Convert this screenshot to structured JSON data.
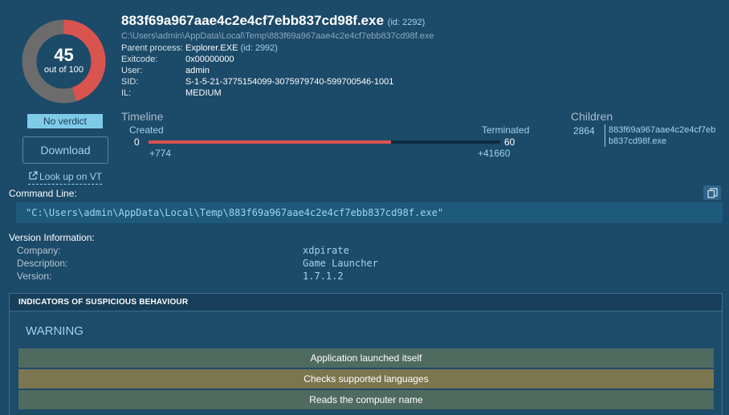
{
  "score": {
    "value": "45",
    "caption": "out of 100",
    "fraction": 0.45,
    "color_danger": "#d9534f",
    "color_track": "#6c6c6c"
  },
  "verdict": "No verdict",
  "download_label": "Download",
  "vt_label": "Look up on VT",
  "process": {
    "name": "883f69a967aae4c2e4cf7ebb837cd98f.exe",
    "id_text": "(id: 2292)",
    "path": "C:\\Users\\admin\\AppData\\Local\\Temp\\883f69a967aae4c2e4cf7ebb837cd98f.exe",
    "fields": [
      {
        "key": "Parent process:",
        "value": "Explorer.EXE",
        "sub": "(id: 2992)"
      },
      {
        "key": "Exitcode:",
        "value": "0x00000000",
        "sub": ""
      },
      {
        "key": "User:",
        "value": "admin",
        "sub": ""
      },
      {
        "key": "SID:",
        "value": "S-1-5-21-3775154099-3075979740-599700546-1001",
        "sub": ""
      },
      {
        "key": "IL:",
        "value": "MEDIUM",
        "sub": ""
      }
    ]
  },
  "timeline": {
    "title": "Timeline",
    "created_label": "Created",
    "terminated_label": "Terminated",
    "start_value": "0",
    "end_value": "60",
    "created_offset": "+774",
    "terminated_offset": "+41660",
    "fill_fraction": 0.69
  },
  "children": {
    "title": "Children",
    "items": [
      {
        "pid": "2864",
        "name": "883f69a967aae4c2e4cf7ebb837cd98f.exe"
      }
    ]
  },
  "command_line": {
    "label": "Command Line:",
    "value": "\"C:\\Users\\admin\\AppData\\Local\\Temp\\883f69a967aae4c2e4cf7ebb837cd98f.exe\""
  },
  "version_info": {
    "label": "Version Information:",
    "rows": [
      {
        "key": "Company:",
        "value": "xdpirate"
      },
      {
        "key": "Description:",
        "value": "Game Launcher"
      },
      {
        "key": "Version:",
        "value": "1.7.1.2"
      }
    ]
  },
  "indicators": {
    "header": "INDICATORS OF SUSPICIOUS BEHAVIOUR",
    "level": "WARNING",
    "items": [
      {
        "text": "Application launched itself",
        "color": "#4f6b60"
      },
      {
        "text": "Checks supported languages",
        "color": "#7c7650"
      },
      {
        "text": "Reads the computer name",
        "color": "#4f6b60"
      }
    ]
  }
}
